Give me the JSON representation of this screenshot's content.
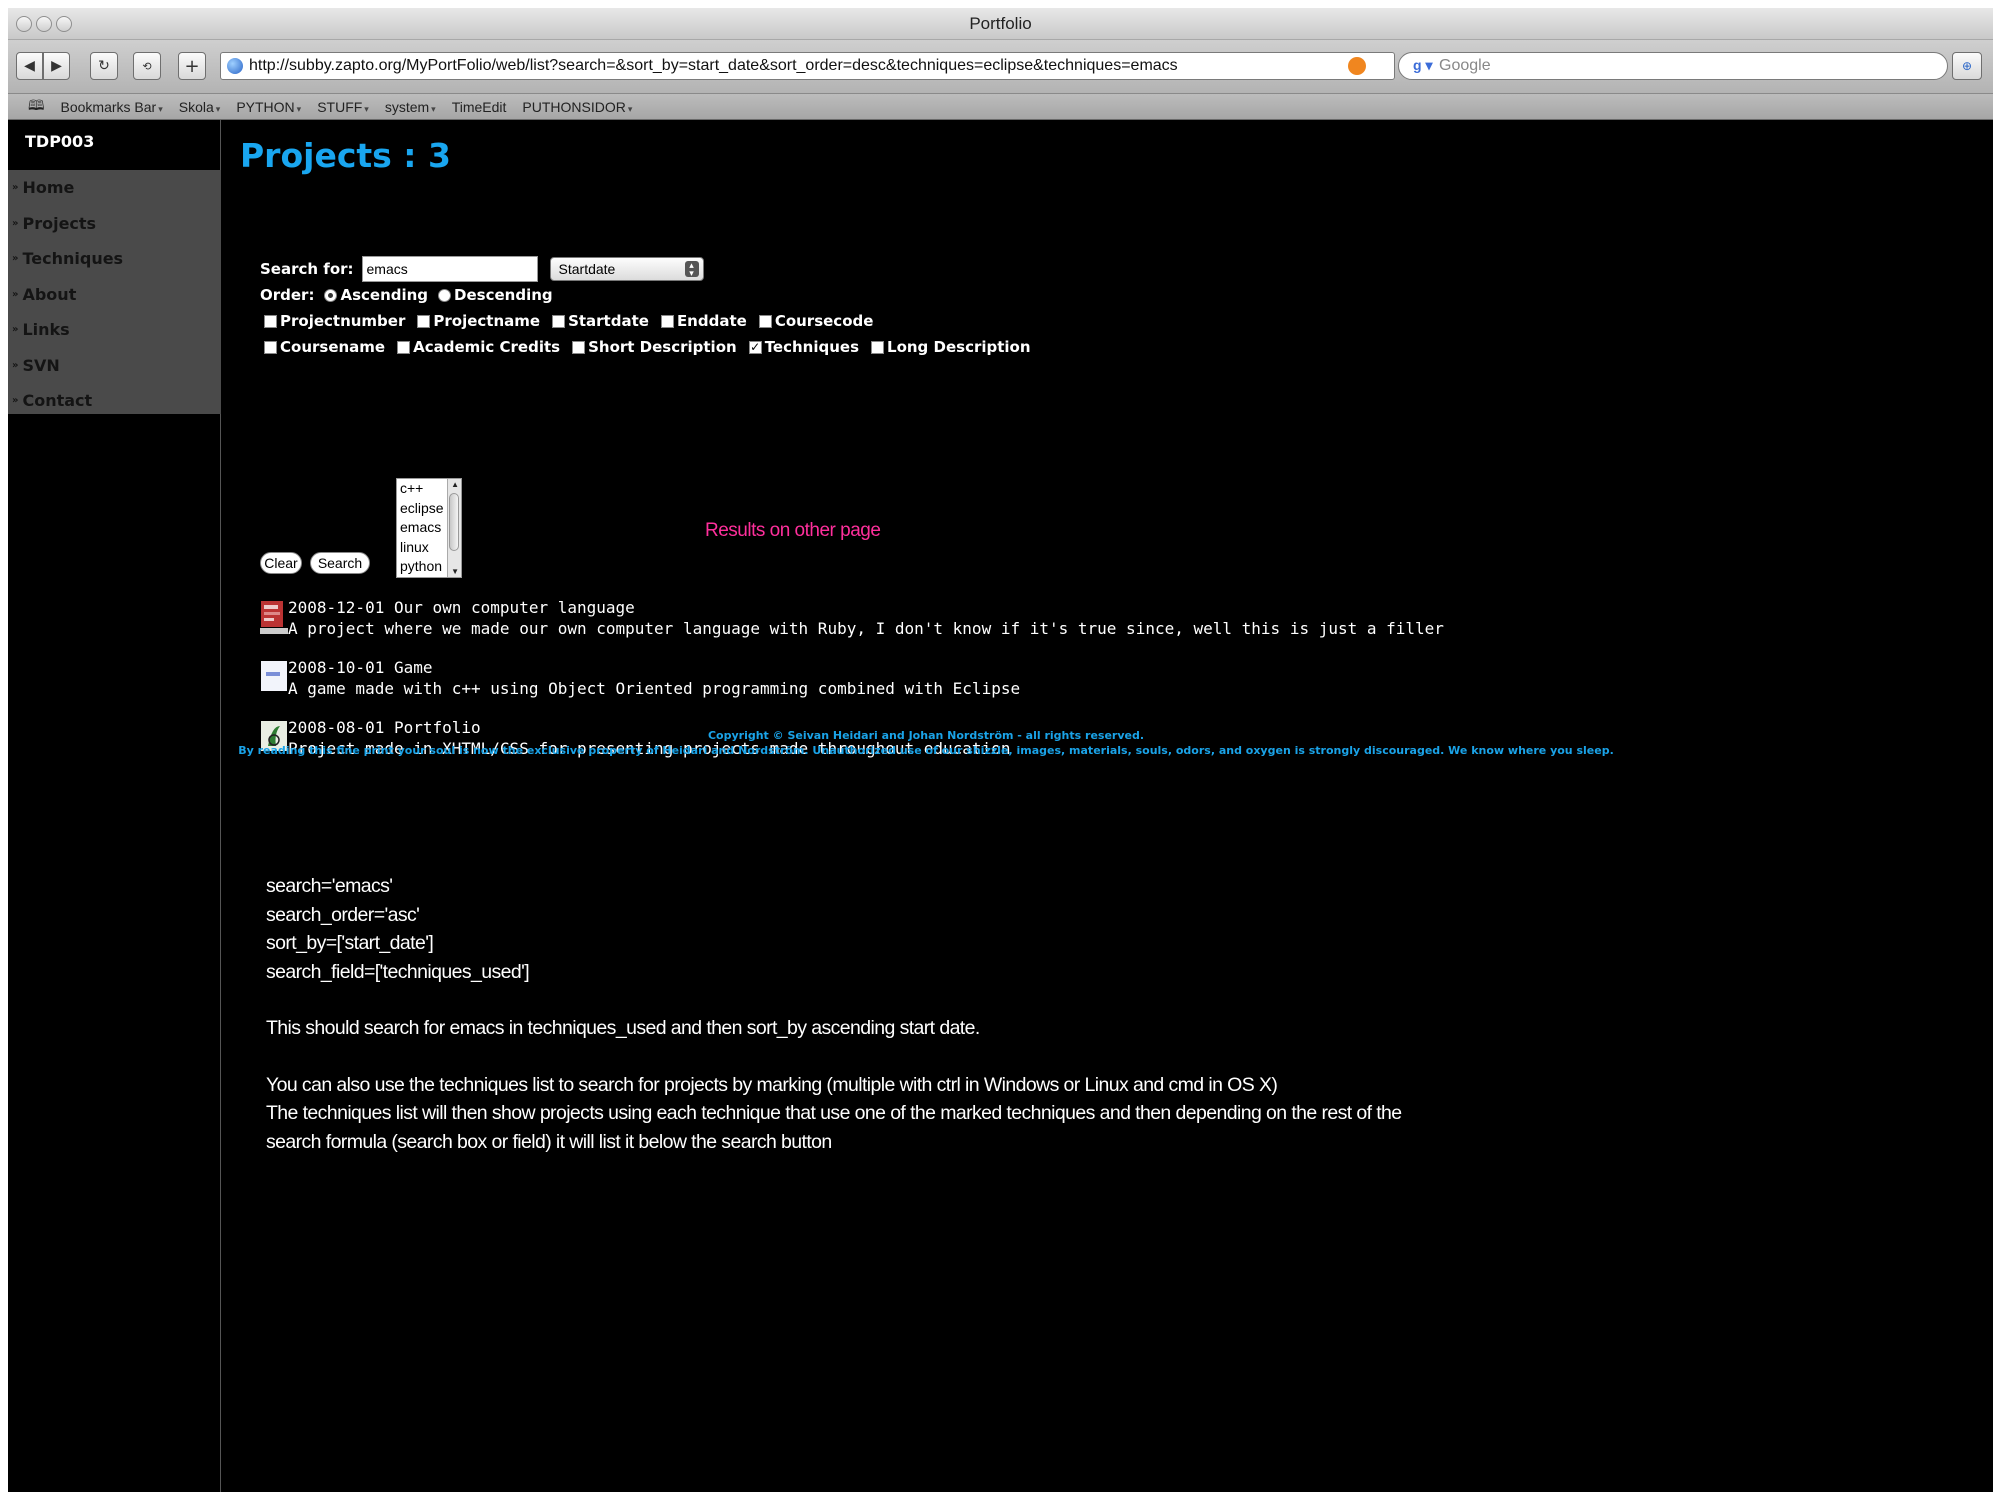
{
  "window": {
    "title": "Portfolio"
  },
  "toolbar": {
    "back_icon": "back-arrow-icon",
    "forward_icon": "forward-arrow-icon",
    "reload_icon": "reload-icon",
    "add_icon": "plus-icon",
    "url": "http://subby.zapto.org/MyPortFolio/web/list?search=&sort_by=start_date&sort_order=desc&techniques=eclipse&techniques=emacs",
    "search_placeholder": "Google"
  },
  "bookmarks": [
    {
      "label": "Bookmarks Bar",
      "has_menu": true
    },
    {
      "label": "Skola",
      "has_menu": true
    },
    {
      "label": "PYTHON",
      "has_menu": true
    },
    {
      "label": "STUFF",
      "has_menu": true
    },
    {
      "label": "system",
      "has_menu": true
    },
    {
      "label": "TimeEdit",
      "has_menu": false
    },
    {
      "label": "PUTHONSIDOR",
      "has_menu": true
    }
  ],
  "sidebar": {
    "site_title": "TDP003",
    "items": [
      {
        "label": "Home"
      },
      {
        "label": "Projects"
      },
      {
        "label": "Techniques"
      },
      {
        "label": "About"
      },
      {
        "label": "Links"
      },
      {
        "label": "SVN"
      },
      {
        "label": "Contact"
      }
    ]
  },
  "main": {
    "title": "Projects : 3",
    "search_label": "Search for:",
    "search_value": "emacs",
    "sort_select": "Startdate",
    "order_label": "Order:",
    "order_options": [
      "Ascending",
      "Descending"
    ],
    "order_selected": "Ascending",
    "fields_row1": [
      {
        "label": "Projectnumber",
        "checked": false
      },
      {
        "label": "Projectname",
        "checked": false
      },
      {
        "label": "Startdate",
        "checked": false
      },
      {
        "label": "Enddate",
        "checked": false
      },
      {
        "label": "Coursecode",
        "checked": false
      }
    ],
    "fields_row2": [
      {
        "label": "Coursename",
        "checked": false
      },
      {
        "label": "Academic Credits",
        "checked": false
      },
      {
        "label": "Short Description",
        "checked": false
      },
      {
        "label": "Techniques",
        "checked": true
      },
      {
        "label": "Long Description",
        "checked": false
      }
    ],
    "techniques_list": [
      "c++",
      "eclipse",
      "emacs",
      "linux",
      "python"
    ],
    "clear_label": "Clear",
    "search_button_label": "Search",
    "other_page_note": "Results on other page",
    "results": [
      {
        "title": "2008-12-01 Our own computer language",
        "description": "A project where we made our own computer language with Ruby, I don't know if it's true since, well this is just a filler"
      },
      {
        "title": "2008-10-01 Game",
        "description": "A game made with c++ using Object Oriented programming combined with Eclipse"
      },
      {
        "title": "2008-08-01 Portfolio",
        "description": "Project made in XHTML/CSS for presenting projects made throughout education"
      }
    ],
    "copyright_line1": "Copyright © Seivan Heidari and Johan Nordström - all rights reserved.",
    "copyright_line2": "By reading this fine print your soul is now the exclusive property of Heidari and Nordström. Unauthorized use of our shizzle, images, materials, souls, odors, and oxygen is strongly discouraged. We know where you sleep."
  },
  "notes": {
    "line1": "search='emacs'",
    "line2": "search_order='asc'",
    "line3": "sort_by=['start_date']",
    "line4": "search_field=['techniques_used']",
    "line5": "This should search for emacs in techniques_used and then sort_by ascending start date.",
    "line6": "You can also use the techniques list to search for projects by marking (multiple with ctrl in Windows or Linux and cmd in OS X)",
    "line7": "The techniques list will then show projects using each technique that use one of the marked techniques and then depending on the rest of the",
    "line8": "search formula (search box or field) it will list it below the search button"
  },
  "colors": {
    "heading": "#19a6f0",
    "copyright": "#1aa3e8",
    "other_page_note": "#ff2f9c",
    "menu_bg": "#4a4a4a",
    "page_bg": "#000000"
  }
}
